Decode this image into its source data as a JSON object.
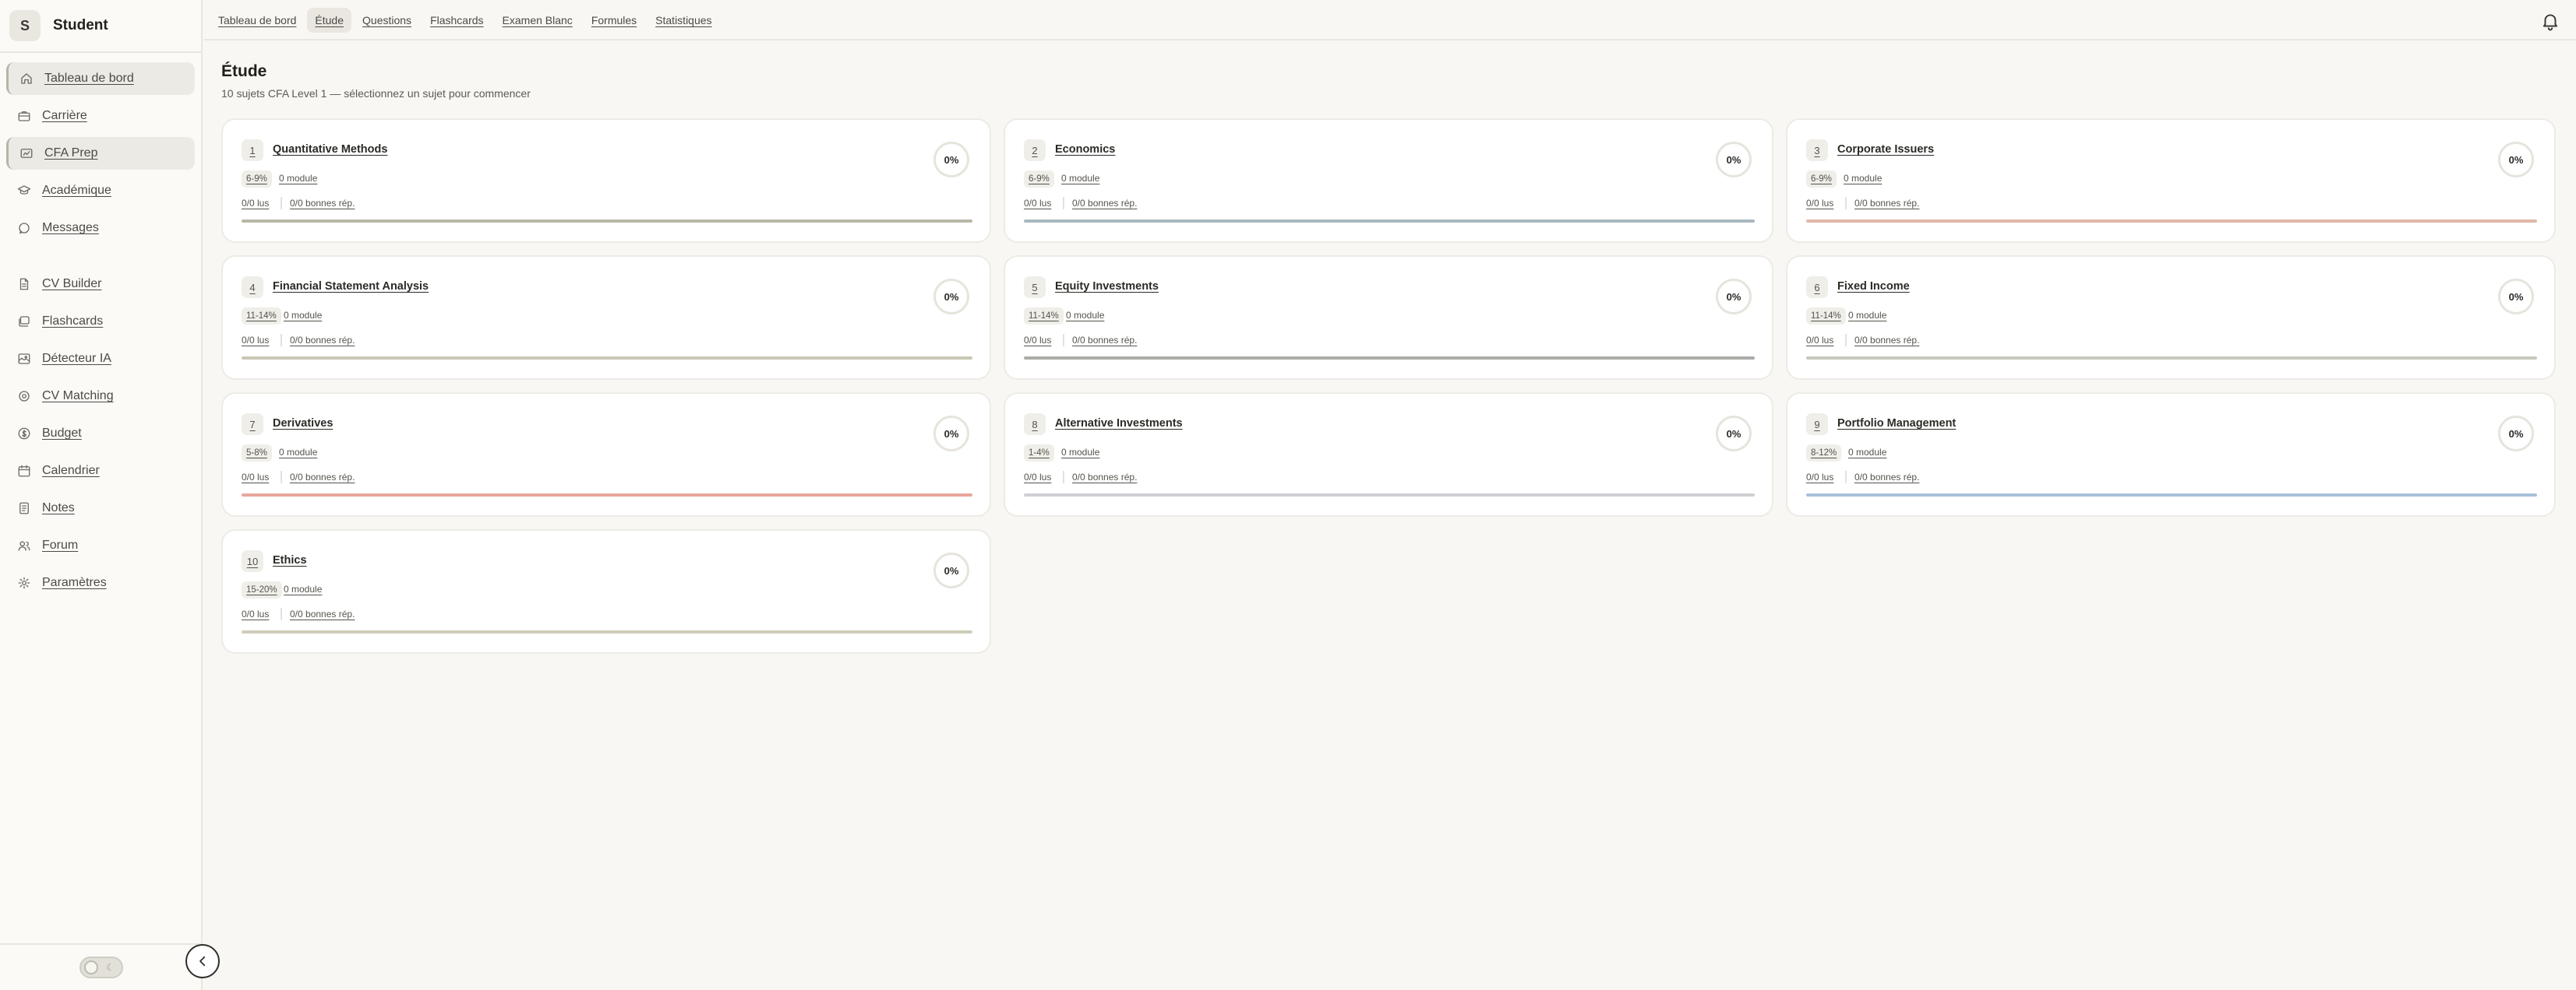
{
  "brand": {
    "initial": "S",
    "name": "Student"
  },
  "sidebar": {
    "items": [
      {
        "label": "Tableau de bord",
        "icon": "home-icon",
        "active": true
      },
      {
        "label": "Carrière",
        "icon": "briefcase-icon",
        "active": false
      },
      {
        "label": "CFA Prep",
        "icon": "chart-icon",
        "active": true
      },
      {
        "label": "Académique",
        "icon": "graduation-cap-icon",
        "active": false
      },
      {
        "label": "Messages",
        "icon": "message-icon",
        "active": false
      },
      {
        "label": "CV Builder",
        "icon": "document-icon",
        "active": false
      },
      {
        "label": "Flashcards",
        "icon": "cards-icon",
        "active": false
      },
      {
        "label": "Détecteur IA",
        "icon": "image-scan-icon",
        "active": false
      },
      {
        "label": "CV Matching",
        "icon": "target-icon",
        "active": false
      },
      {
        "label": "Budget",
        "icon": "dollar-icon",
        "active": false
      },
      {
        "label": "Calendrier",
        "icon": "calendar-icon",
        "active": false
      },
      {
        "label": "Notes",
        "icon": "notes-icon",
        "active": false
      },
      {
        "label": "Forum",
        "icon": "users-icon",
        "active": false
      },
      {
        "label": "Paramètres",
        "icon": "gear-icon",
        "active": false
      }
    ]
  },
  "topbar": {
    "tabs": [
      {
        "label": "Tableau de bord",
        "active": false
      },
      {
        "label": "Étude",
        "active": true
      },
      {
        "label": "Questions",
        "active": false
      },
      {
        "label": "Flashcards",
        "active": false
      },
      {
        "label": "Examen Blanc",
        "active": false
      },
      {
        "label": "Formules",
        "active": false
      },
      {
        "label": "Statistiques",
        "active": false
      }
    ]
  },
  "page": {
    "title": "Étude",
    "subtitle": "10 sujets CFA Level 1 — sélectionnez un sujet pour commencer"
  },
  "topics": [
    {
      "num": "1",
      "title": "Quantitative Methods",
      "weight": "6-9%",
      "modules": "0 module",
      "read": "0/0 lus",
      "correct": "0/0 bonnes rép.",
      "percent": "0%",
      "progress": 0,
      "color": "#b9b7a6"
    },
    {
      "num": "2",
      "title": "Economics",
      "weight": "6-9%",
      "modules": "0 module",
      "read": "0/0 lus",
      "correct": "0/0 bonnes rép.",
      "percent": "0%",
      "progress": 0,
      "color": "#a9b8c0"
    },
    {
      "num": "3",
      "title": "Corporate Issuers",
      "weight": "6-9%",
      "modules": "0 module",
      "read": "0/0 lus",
      "correct": "0/0 bonnes rép.",
      "percent": "0%",
      "progress": 0,
      "color": "#e0b8a8"
    },
    {
      "num": "4",
      "title": "Financial Statement Analysis",
      "weight": "11-14%",
      "modules": "0 module",
      "read": "0/0 lus",
      "correct": "0/0 bonnes rép.",
      "percent": "0%",
      "progress": 0,
      "color": "#c9c8b5"
    },
    {
      "num": "5",
      "title": "Equity Investments",
      "weight": "11-14%",
      "modules": "0 module",
      "read": "0/0 lus",
      "correct": "0/0 bonnes rép.",
      "percent": "0%",
      "progress": 0,
      "color": "#a9aca8"
    },
    {
      "num": "6",
      "title": "Fixed Income",
      "weight": "11-14%",
      "modules": "0 module",
      "read": "0/0 lus",
      "correct": "0/0 bonnes rép.",
      "percent": "0%",
      "progress": 0,
      "color": "#c8c8bd"
    },
    {
      "num": "7",
      "title": "Derivatives",
      "weight": "5-8%",
      "modules": "0 module",
      "read": "0/0 lus",
      "correct": "0/0 bonnes rép.",
      "percent": "0%",
      "progress": 0,
      "color": "#e8a79c"
    },
    {
      "num": "8",
      "title": "Alternative Investments",
      "weight": "1-4%",
      "modules": "0 module",
      "read": "0/0 lus",
      "correct": "0/0 bonnes rép.",
      "percent": "0%",
      "progress": 0,
      "color": "#cfd0d2"
    },
    {
      "num": "9",
      "title": "Portfolio Management",
      "weight": "8-12%",
      "modules": "0 module",
      "read": "0/0 lus",
      "correct": "0/0 bonnes rép.",
      "percent": "0%",
      "progress": 0,
      "color": "#a9bfdc"
    },
    {
      "num": "10",
      "title": "Ethics",
      "weight": "15-20%",
      "modules": "0 module",
      "read": "0/0 lus",
      "correct": "0/0 bonnes rép.",
      "percent": "0%",
      "progress": 0,
      "color": "#cfcdb8"
    }
  ],
  "icons": {
    "bell": "bell-icon",
    "collapse": "chevron-left-icon",
    "toggle": "theme-toggle"
  }
}
